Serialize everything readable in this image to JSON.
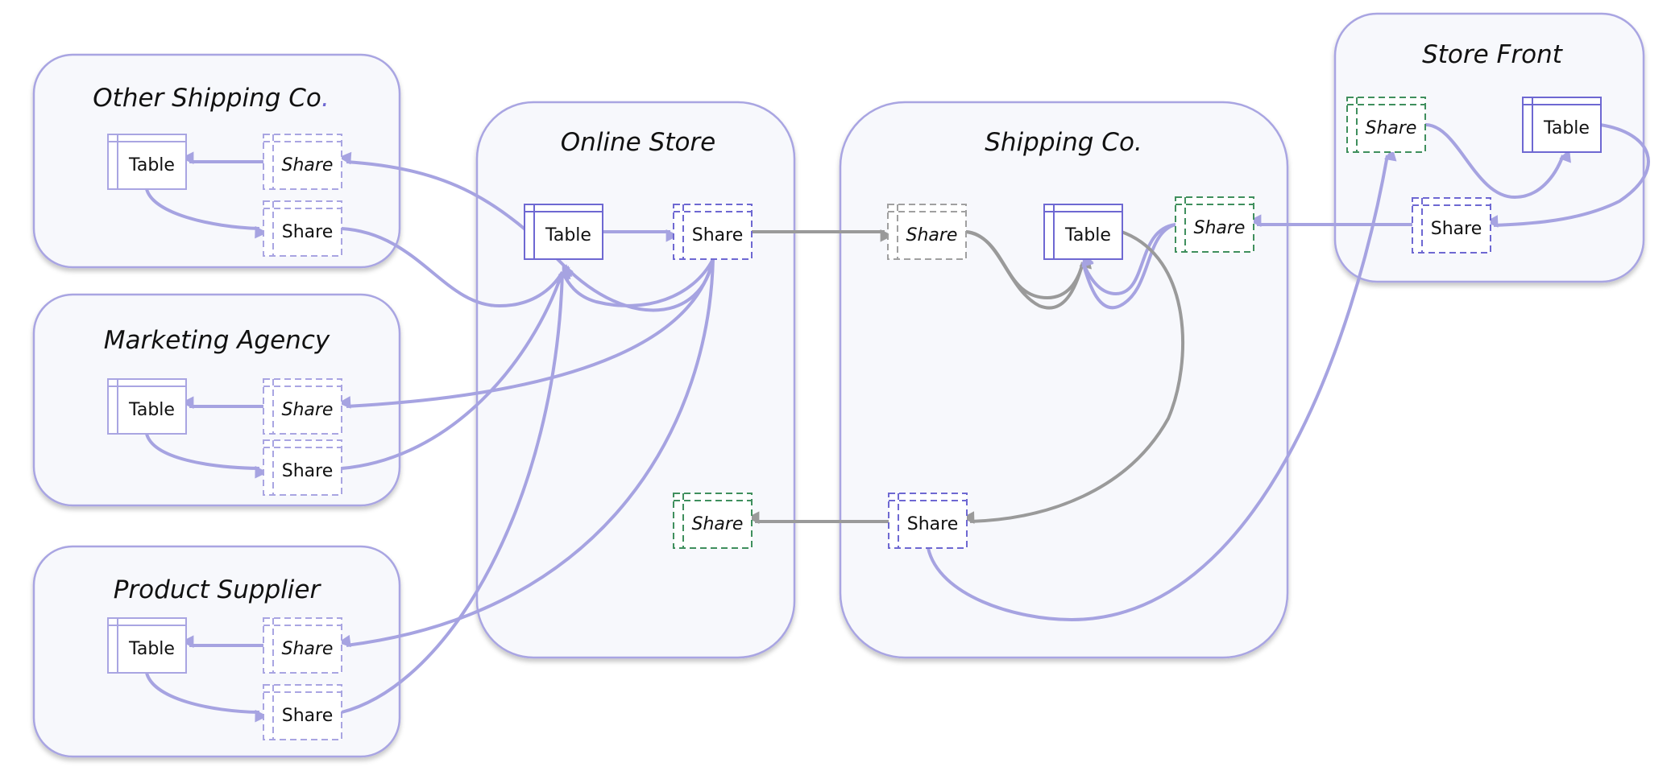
{
  "colors": {
    "edge_purple": "#a6a3e1",
    "edge_gray": "#9a9a9a",
    "share_green": "#3f8f5d",
    "share_gray": "#a0a0a0",
    "node_dark": "#6e68d2",
    "node_light": "#a9a5e2",
    "box_fill": "#f7f8fc"
  },
  "organizations": [
    {
      "id": "other-shipping",
      "title": "Other Shipping Co",
      "title_suffix": ".",
      "nodes": [
        {
          "id": "os-table",
          "type": "table",
          "label": "Table",
          "style": "light"
        },
        {
          "id": "os-share-in",
          "type": "share",
          "label": "Share",
          "italic": true,
          "style": "light"
        },
        {
          "id": "os-share-out",
          "type": "share",
          "label": "Share",
          "italic": false,
          "style": "light"
        }
      ]
    },
    {
      "id": "marketing",
      "title": "Marketing Agency",
      "nodes": [
        {
          "id": "ma-table",
          "type": "table",
          "label": "Table",
          "style": "light"
        },
        {
          "id": "ma-share-in",
          "type": "share",
          "label": "Share",
          "italic": true,
          "style": "light"
        },
        {
          "id": "ma-share-out",
          "type": "share",
          "label": "Share",
          "italic": false,
          "style": "light"
        }
      ]
    },
    {
      "id": "supplier",
      "title": "Product Supplier",
      "nodes": [
        {
          "id": "ps-table",
          "type": "table",
          "label": "Table",
          "style": "light"
        },
        {
          "id": "ps-share-in",
          "type": "share",
          "label": "Share",
          "italic": true,
          "style": "light"
        },
        {
          "id": "ps-share-out",
          "type": "share",
          "label": "Share",
          "italic": false,
          "style": "light"
        }
      ]
    },
    {
      "id": "online-store",
      "title": "Online Store",
      "nodes": [
        {
          "id": "ol-table",
          "type": "table",
          "label": "Table",
          "style": "dark"
        },
        {
          "id": "ol-share-out",
          "type": "share",
          "label": "Share",
          "italic": false,
          "style": "dark"
        },
        {
          "id": "ol-share-in",
          "type": "share",
          "label": "Share",
          "italic": true,
          "style": "green"
        }
      ]
    },
    {
      "id": "shipping",
      "title": "Shipping Co.",
      "nodes": [
        {
          "id": "sc-share-in",
          "type": "share",
          "label": "Share",
          "italic": true,
          "style": "gray"
        },
        {
          "id": "sc-table",
          "type": "table",
          "label": "Table",
          "style": "dark"
        },
        {
          "id": "sc-share-in2",
          "type": "share",
          "label": "Share",
          "italic": true,
          "style": "green"
        },
        {
          "id": "sc-share-out",
          "type": "share",
          "label": "Share",
          "italic": false,
          "style": "dark"
        }
      ]
    },
    {
      "id": "store-front",
      "title": "Store Front",
      "nodes": [
        {
          "id": "sf-share-in",
          "type": "share",
          "label": "Share",
          "italic": true,
          "style": "green"
        },
        {
          "id": "sf-table",
          "type": "table",
          "label": "Table",
          "style": "dark"
        },
        {
          "id": "sf-share-out",
          "type": "share",
          "label": "Share",
          "italic": false,
          "style": "dark"
        }
      ]
    }
  ],
  "edges": [
    {
      "from": "os-share-in",
      "to": "os-table",
      "color": "purple"
    },
    {
      "from": "os-table",
      "to": "os-share-out",
      "color": "purple"
    },
    {
      "from": "ma-share-in",
      "to": "ma-table",
      "color": "purple"
    },
    {
      "from": "ma-table",
      "to": "ma-share-out",
      "color": "purple"
    },
    {
      "from": "ps-share-in",
      "to": "ps-table",
      "color": "purple"
    },
    {
      "from": "ps-table",
      "to": "ps-share-out",
      "color": "purple"
    },
    {
      "from": "ol-table",
      "to": "ol-share-out",
      "color": "purple"
    },
    {
      "from": "ol-share-out",
      "to": "os-share-in",
      "color": "purple"
    },
    {
      "from": "ol-share-out",
      "to": "ma-share-in",
      "color": "purple"
    },
    {
      "from": "ol-share-out",
      "to": "ps-share-in",
      "color": "purple"
    },
    {
      "from": "ol-share-out",
      "to": "ol-table",
      "color": "purple"
    },
    {
      "from": "os-share-out",
      "to": "ol-table",
      "color": "purple"
    },
    {
      "from": "ma-share-out",
      "to": "ol-table",
      "color": "purple"
    },
    {
      "from": "ps-share-out",
      "to": "ol-table",
      "color": "purple"
    },
    {
      "from": "ol-share-out",
      "to": "sc-share-in",
      "color": "gray"
    },
    {
      "from": "sc-share-in",
      "to": "sc-table",
      "color": "gray"
    },
    {
      "from": "sc-share-in2",
      "to": "sc-table",
      "color": "purple"
    },
    {
      "from": "sc-table",
      "to": "sc-share-out",
      "color": "gray"
    },
    {
      "from": "sc-share-out",
      "to": "ol-share-in",
      "color": "gray"
    },
    {
      "from": "sc-share-out",
      "to": "sf-share-in",
      "color": "purple"
    },
    {
      "from": "sf-share-out",
      "to": "sc-share-in2",
      "color": "purple"
    },
    {
      "from": "sf-share-in",
      "to": "sf-table",
      "color": "purple"
    },
    {
      "from": "sf-table",
      "to": "sf-share-out",
      "color": "purple"
    }
  ]
}
